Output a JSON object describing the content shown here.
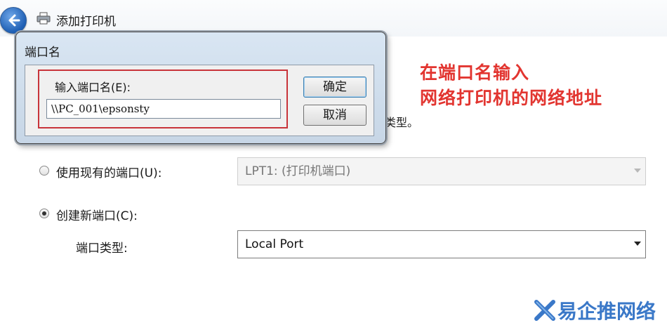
{
  "window": {
    "title": "添加打印机"
  },
  "background": {
    "partial_text": "类型。",
    "use_existing_label": "使用现有的端口(U):",
    "existing_port_value": "LPT1: (打印机端口)",
    "create_new_label": "创建新端口(C):",
    "port_type_label": "端口类型:",
    "port_type_value": "Local Port",
    "selected_option": "create_new"
  },
  "dialog": {
    "title": "端口名",
    "field_label": "输入端口名(E):",
    "field_value": "\\\\PC_001\\epsonsty",
    "ok_label": "确定",
    "cancel_label": "取消"
  },
  "annotation": {
    "line1": "在端口名输入",
    "line2": "网络打印机的网络地址"
  },
  "watermark": {
    "text": "易企推网络"
  },
  "colors": {
    "annotation": "#e23530",
    "highlight": "#c8343a",
    "accent": "#1e5fb4"
  }
}
